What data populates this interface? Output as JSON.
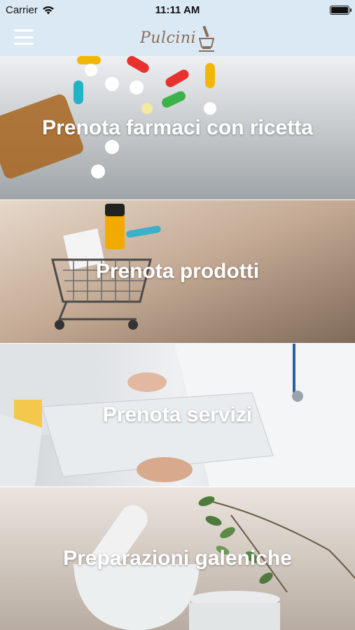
{
  "status_bar": {
    "carrier": "Carrier",
    "time": "11:11 AM"
  },
  "nav_bar": {
    "logo_text": "Pulcini"
  },
  "tiles": [
    {
      "label": "Prenota farmaci con ricetta"
    },
    {
      "label": "Prenota prodotti"
    },
    {
      "label": "Prenota servizi"
    },
    {
      "label": "Preparazioni galeniche"
    }
  ],
  "colors": {
    "header_bg": "#dbe9f5",
    "logo": "#8a6d57",
    "tile_text": "#ffffff"
  }
}
